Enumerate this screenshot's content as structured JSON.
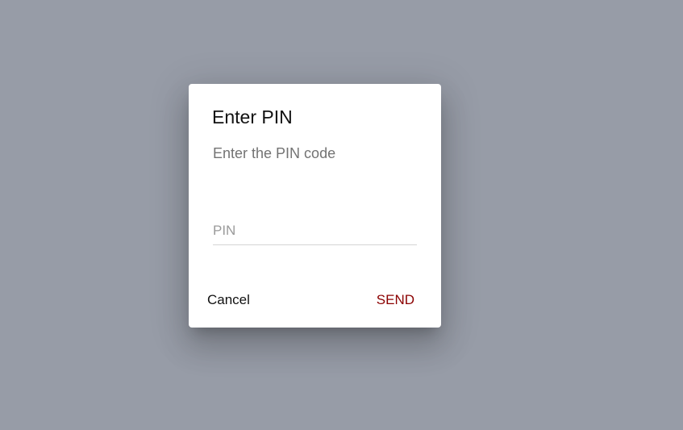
{
  "dialog": {
    "title": "Enter PIN",
    "message": "Enter the PIN code",
    "pin_input": {
      "placeholder": "PIN",
      "value": ""
    },
    "actions": {
      "cancel_label": "Cancel",
      "send_label": "SEND"
    }
  },
  "colors": {
    "backdrop": "#979ca7",
    "dialog_background": "#ffffff",
    "send_accent": "#8b0000"
  }
}
